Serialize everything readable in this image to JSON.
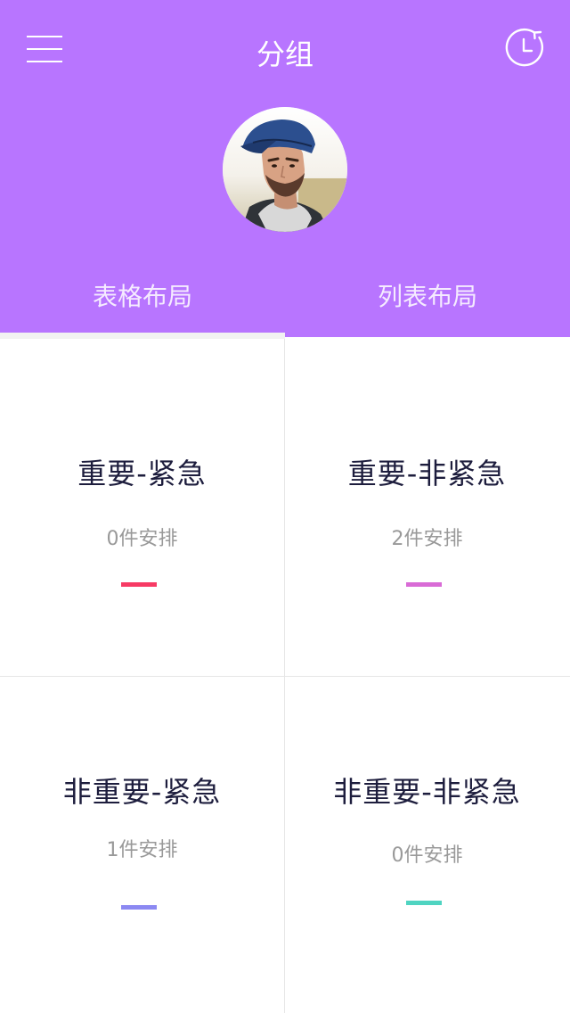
{
  "header": {
    "title": "分组",
    "menu_icon": "hamburger-menu-icon",
    "history_icon": "history-clock-icon",
    "background": "#b875ff"
  },
  "profile": {
    "avatar_icon": "user-avatar"
  },
  "tabs": [
    {
      "label": "表格布局",
      "active": true
    },
    {
      "label": "列表布局",
      "active": false
    }
  ],
  "groups": [
    {
      "title": "重要-紧急",
      "count": "0件安排",
      "color": "#f73a64"
    },
    {
      "title": "重要-非紧急",
      "count": "2件安排",
      "color": "#d96bd6"
    },
    {
      "title": "非重要-紧急",
      "count": "1件安排",
      "color": "#8c89f2"
    },
    {
      "title": "非重要-非紧急",
      "count": "0件安排",
      "color": "#4fd4c1"
    }
  ]
}
